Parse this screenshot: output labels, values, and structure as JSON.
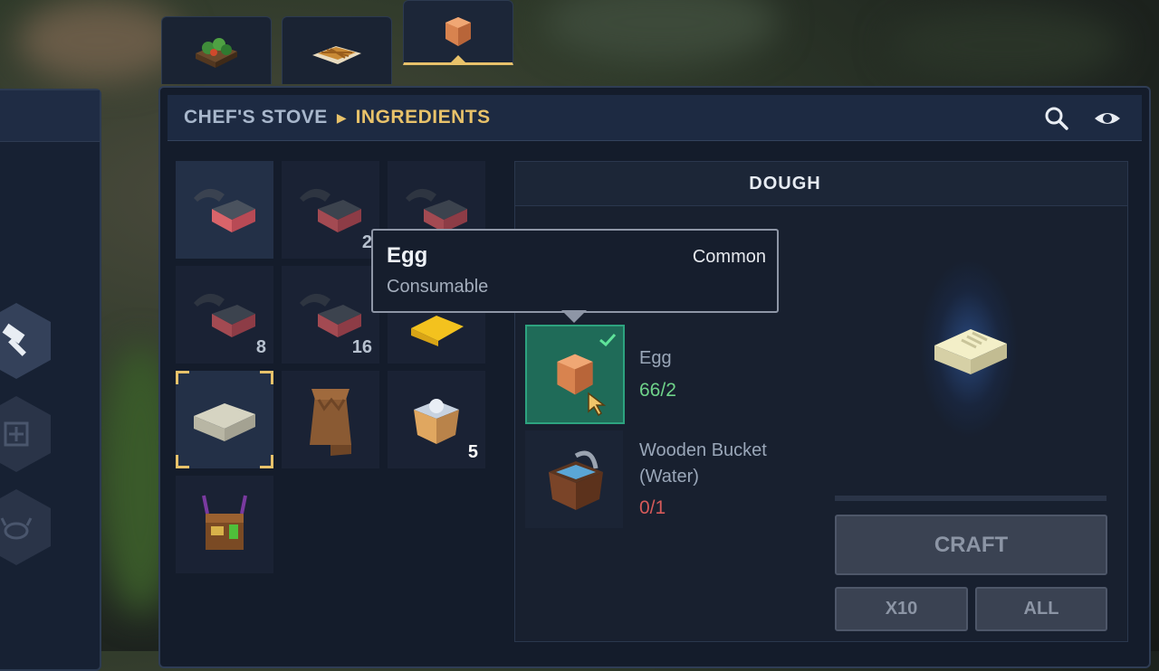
{
  "breadcrumb": {
    "station": "CHEF'S STOVE",
    "category": "INGREDIENTS"
  },
  "header_icons": [
    "search-icon",
    "eye-icon"
  ],
  "category_tabs": [
    {
      "icon": "salad-icon",
      "active": false
    },
    {
      "icon": "pie-icon",
      "active": false
    },
    {
      "icon": "egg-icon",
      "active": true
    }
  ],
  "side_tools": [
    "hammer-icon",
    "emblem-icon",
    "crab-icon"
  ],
  "inventory": [
    {
      "icon": "fish-meat-icon",
      "count": "",
      "highlighted": true
    },
    {
      "icon": "fish-meat-icon",
      "count": "2"
    },
    {
      "icon": "fish-meat-icon",
      "count": ""
    },
    {
      "icon": "fish-meat-icon",
      "count": "8"
    },
    {
      "icon": "fish-meat-icon",
      "count": "16"
    },
    {
      "icon": "cheese-icon",
      "count": ""
    },
    {
      "icon": "dough-icon",
      "count": "",
      "selected": true
    },
    {
      "icon": "flour-sack-icon",
      "count": ""
    },
    {
      "icon": "salt-bucket-icon",
      "count": "5"
    },
    {
      "icon": "market-stall-icon",
      "count": ""
    }
  ],
  "recipe": {
    "title": "DOUGH",
    "ingredients": [
      {
        "name": "Egg",
        "count": "66/2",
        "status": "ok",
        "icon": "egg-icon",
        "selected": true
      },
      {
        "name": "Wooden Bucket",
        "name2": "(Water)",
        "count": "0/1",
        "status": "missing",
        "icon": "water-bucket-icon"
      }
    ]
  },
  "tooltip": {
    "name": "Egg",
    "rarity": "Common",
    "type": "Consumable"
  },
  "buttons": {
    "craft": "CRAFT",
    "x10": "X10",
    "all": "ALL"
  },
  "colors": {
    "accent": "#e8c26a",
    "ok": "#6fd38a",
    "missing": "#d65a5a",
    "selected_slot": "#1f6b58"
  }
}
